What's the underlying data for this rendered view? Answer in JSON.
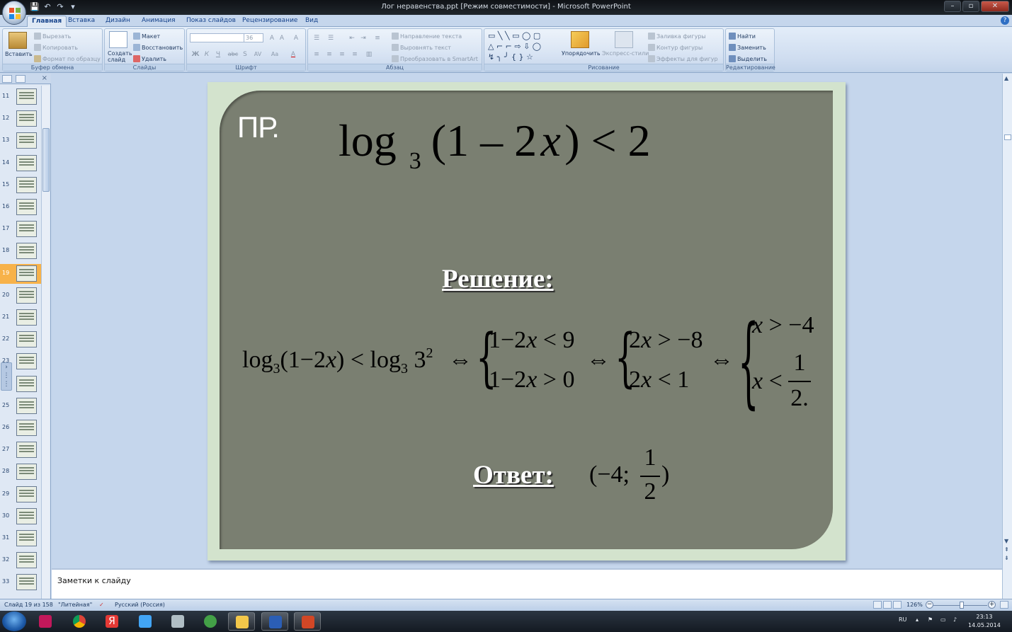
{
  "window": {
    "title": "Лог неравенства.ppt [Режим совместимости] - Microsoft PowerPoint",
    "controls": [
      "–",
      "▫",
      "✕"
    ]
  },
  "qat": [
    "💾",
    "↶",
    "↷",
    "▾"
  ],
  "tabs": [
    "Главная",
    "Вставка",
    "Дизайн",
    "Анимация",
    "Показ слайдов",
    "Рецензирование",
    "Вид"
  ],
  "ribbon": {
    "clipboard": {
      "paste": "Вставить",
      "cut": "Вырезать",
      "copy": "Копировать",
      "format_painter": "Формат по образцу",
      "label": "Буфер обмена"
    },
    "slides": {
      "new_slide_1": "Создать",
      "new_slide_2": "слайд",
      "layout": "Макет",
      "reset": "Восстановить",
      "delete": "Удалить",
      "label": "Слайды"
    },
    "font": {
      "size": "36",
      "label": "Шрифт",
      "buttons": [
        "Ж",
        "К",
        "Ч",
        "abc",
        "S",
        "AV",
        "Aa",
        "A"
      ]
    },
    "paragraph": {
      "text_direction": "Направление текста",
      "align_text": "Выровнять текст",
      "smartart": "Преобразовать в SmartArt",
      "label": "Абзац"
    },
    "drawing": {
      "arrange": "Упорядочить",
      "quick_styles": "Экспресс-стили",
      "fill": "Заливка фигуры",
      "outline": "Контур фигуры",
      "effects": "Эффекты для фигур",
      "label": "Рисование"
    },
    "editing": {
      "find": "Найти",
      "replace": "Заменить",
      "select": "Выделить",
      "label": "Редактирование"
    }
  },
  "thumbnails": {
    "numbers": [
      "11",
      "12",
      "13",
      "14",
      "15",
      "16",
      "17",
      "18",
      "19",
      "20",
      "21",
      "22",
      "23",
      "24",
      "25",
      "26",
      "27",
      "28",
      "29",
      "30",
      "31",
      "32",
      "33"
    ],
    "selected": "19"
  },
  "slide": {
    "label": "ПР.",
    "title_eq": {
      "log": "log",
      "base": "3",
      "body": "(1 – 2",
      "var": "x",
      "tail": ") < 2"
    },
    "solution_heading": "Решение:",
    "answer_heading": "Ответ:",
    "equation": {
      "lhs": "log₃(1−2x) < log₃ 3²",
      "iff": "⇔",
      "sys1": [
        "1−2x < 9",
        "1−2x > 0"
      ],
      "sys2": [
        "2x > −8",
        "2x < 1"
      ],
      "sys3_top": "x > −4",
      "sys3_bottom_prefix": "x <",
      "sys3_frac_num": "1",
      "sys3_frac_den": "2."
    },
    "answer": {
      "open": "(−4;",
      "num": "1",
      "den": "2",
      "close": ")"
    }
  },
  "notes": {
    "placeholder": "Заметки к слайду"
  },
  "status": {
    "slide_pos": "Слайд 19 из 158",
    "theme": "\"Литейная\"",
    "language": "Русский (Россия)",
    "zoom": "126%"
  },
  "taskbar": {
    "lang": "RU",
    "time": "23:13",
    "date": "14.05.2014"
  },
  "colors": {
    "slide_bg": "#7a7f71",
    "slide_frame": "#d3e3cd",
    "ribbon": "#dfe9f5",
    "selected_thumb": "#f7b24a"
  }
}
